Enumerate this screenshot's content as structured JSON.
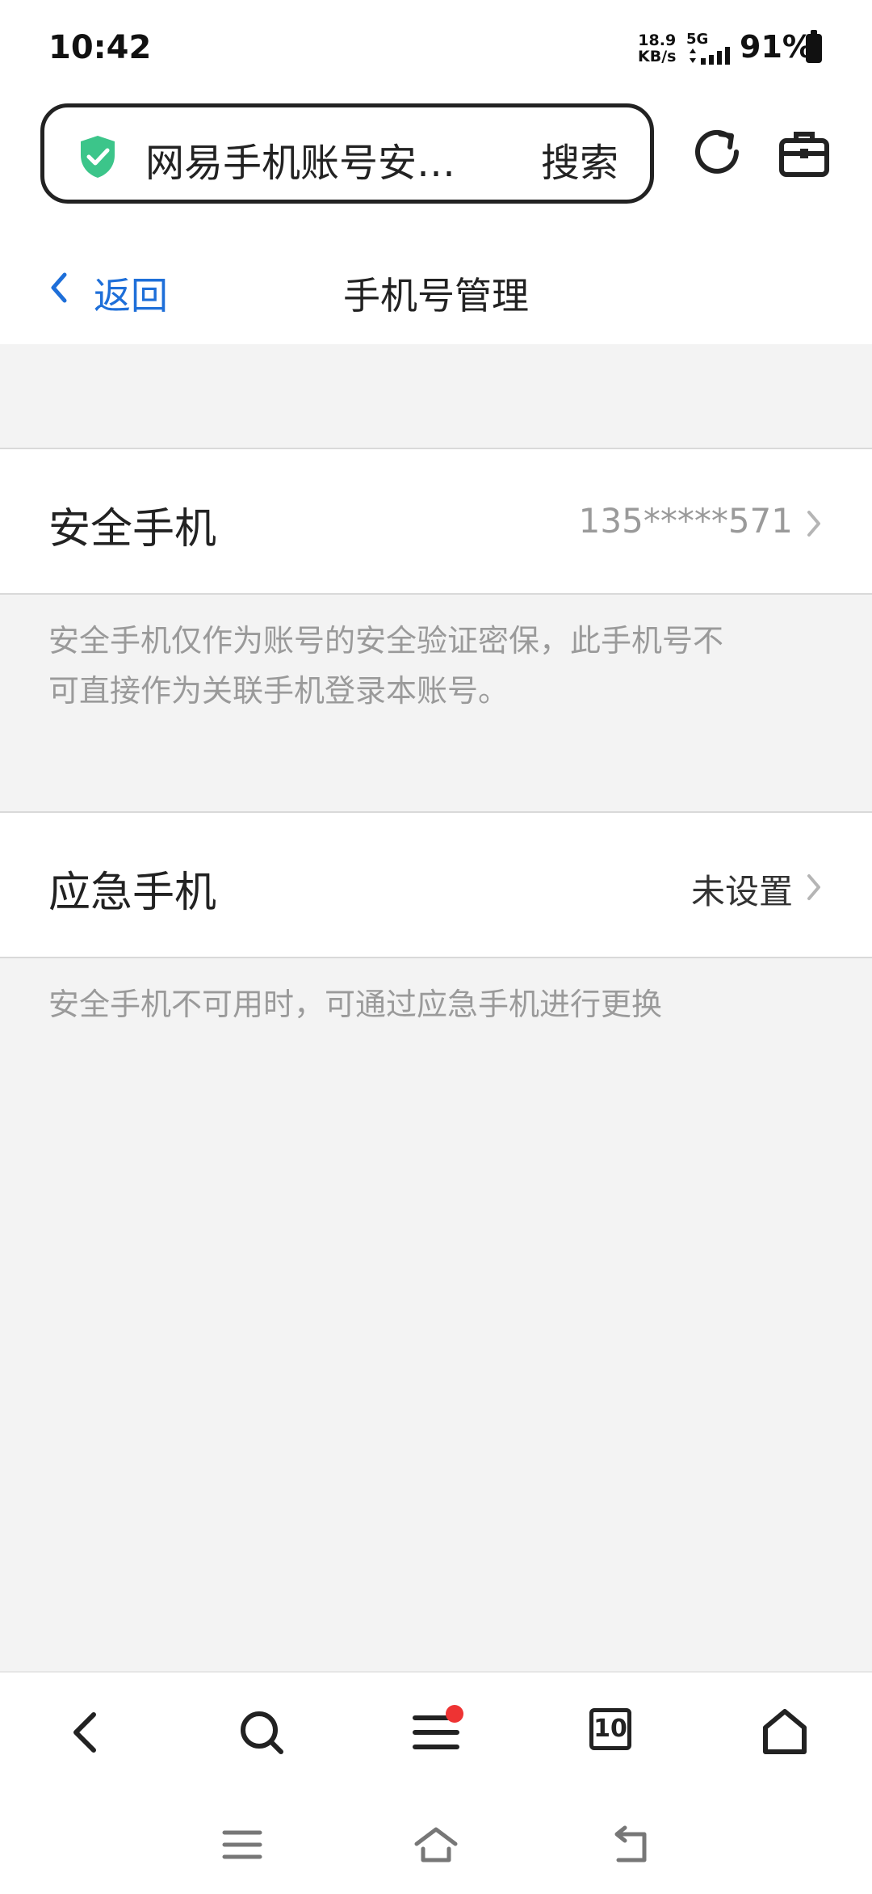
{
  "status_bar": {
    "time": "10:42",
    "net_speed_value": "18.9",
    "net_speed_unit": "KB/s",
    "network": "5G",
    "battery": "91%"
  },
  "address_bar": {
    "title": "网易手机账号安…",
    "search_label": "搜索",
    "security_icon": "shield-check-icon",
    "colors": {
      "shield": "#3cc58a"
    }
  },
  "header": {
    "back_label": "返回",
    "title": "手机号管理",
    "colors": {
      "back": "#1e6fd9"
    }
  },
  "settings": [
    {
      "label": "安全手机",
      "value": "135*****571",
      "note_line1": "安全手机仅作为账号的安全验证密保，此手机号不",
      "note_line2": "可直接作为关联手机登录本账号。"
    },
    {
      "label": "应急手机",
      "value": "未设置",
      "note_line1": "安全手机不可用时，可通过应急手机进行更换"
    }
  ],
  "browser_nav": {
    "tab_count": "10",
    "icons": [
      "back-icon",
      "search-icon",
      "menu-icon",
      "tabs-icon",
      "home-icon"
    ],
    "colors": {
      "badge": "#ee3333"
    }
  },
  "system_nav": {
    "icons": [
      "recent-apps-icon",
      "home-icon",
      "back-icon"
    ]
  }
}
